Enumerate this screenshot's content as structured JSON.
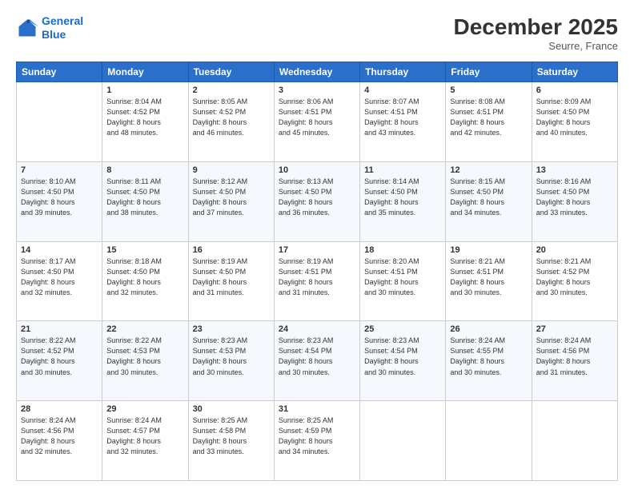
{
  "header": {
    "logo_line1": "General",
    "logo_line2": "Blue",
    "month": "December 2025",
    "location": "Seurre, France"
  },
  "days": [
    "Sunday",
    "Monday",
    "Tuesday",
    "Wednesday",
    "Thursday",
    "Friday",
    "Saturday"
  ],
  "weeks": [
    [
      {
        "day": "",
        "content": ""
      },
      {
        "day": "1",
        "content": "Sunrise: 8:04 AM\nSunset: 4:52 PM\nDaylight: 8 hours\nand 48 minutes."
      },
      {
        "day": "2",
        "content": "Sunrise: 8:05 AM\nSunset: 4:52 PM\nDaylight: 8 hours\nand 46 minutes."
      },
      {
        "day": "3",
        "content": "Sunrise: 8:06 AM\nSunset: 4:51 PM\nDaylight: 8 hours\nand 45 minutes."
      },
      {
        "day": "4",
        "content": "Sunrise: 8:07 AM\nSunset: 4:51 PM\nDaylight: 8 hours\nand 43 minutes."
      },
      {
        "day": "5",
        "content": "Sunrise: 8:08 AM\nSunset: 4:51 PM\nDaylight: 8 hours\nand 42 minutes."
      },
      {
        "day": "6",
        "content": "Sunrise: 8:09 AM\nSunset: 4:50 PM\nDaylight: 8 hours\nand 40 minutes."
      }
    ],
    [
      {
        "day": "7",
        "content": "Sunrise: 8:10 AM\nSunset: 4:50 PM\nDaylight: 8 hours\nand 39 minutes."
      },
      {
        "day": "8",
        "content": "Sunrise: 8:11 AM\nSunset: 4:50 PM\nDaylight: 8 hours\nand 38 minutes."
      },
      {
        "day": "9",
        "content": "Sunrise: 8:12 AM\nSunset: 4:50 PM\nDaylight: 8 hours\nand 37 minutes."
      },
      {
        "day": "10",
        "content": "Sunrise: 8:13 AM\nSunset: 4:50 PM\nDaylight: 8 hours\nand 36 minutes."
      },
      {
        "day": "11",
        "content": "Sunrise: 8:14 AM\nSunset: 4:50 PM\nDaylight: 8 hours\nand 35 minutes."
      },
      {
        "day": "12",
        "content": "Sunrise: 8:15 AM\nSunset: 4:50 PM\nDaylight: 8 hours\nand 34 minutes."
      },
      {
        "day": "13",
        "content": "Sunrise: 8:16 AM\nSunset: 4:50 PM\nDaylight: 8 hours\nand 33 minutes."
      }
    ],
    [
      {
        "day": "14",
        "content": "Sunrise: 8:17 AM\nSunset: 4:50 PM\nDaylight: 8 hours\nand 32 minutes."
      },
      {
        "day": "15",
        "content": "Sunrise: 8:18 AM\nSunset: 4:50 PM\nDaylight: 8 hours\nand 32 minutes."
      },
      {
        "day": "16",
        "content": "Sunrise: 8:19 AM\nSunset: 4:50 PM\nDaylight: 8 hours\nand 31 minutes."
      },
      {
        "day": "17",
        "content": "Sunrise: 8:19 AM\nSunset: 4:51 PM\nDaylight: 8 hours\nand 31 minutes."
      },
      {
        "day": "18",
        "content": "Sunrise: 8:20 AM\nSunset: 4:51 PM\nDaylight: 8 hours\nand 30 minutes."
      },
      {
        "day": "19",
        "content": "Sunrise: 8:21 AM\nSunset: 4:51 PM\nDaylight: 8 hours\nand 30 minutes."
      },
      {
        "day": "20",
        "content": "Sunrise: 8:21 AM\nSunset: 4:52 PM\nDaylight: 8 hours\nand 30 minutes."
      }
    ],
    [
      {
        "day": "21",
        "content": "Sunrise: 8:22 AM\nSunset: 4:52 PM\nDaylight: 8 hours\nand 30 minutes."
      },
      {
        "day": "22",
        "content": "Sunrise: 8:22 AM\nSunset: 4:53 PM\nDaylight: 8 hours\nand 30 minutes."
      },
      {
        "day": "23",
        "content": "Sunrise: 8:23 AM\nSunset: 4:53 PM\nDaylight: 8 hours\nand 30 minutes."
      },
      {
        "day": "24",
        "content": "Sunrise: 8:23 AM\nSunset: 4:54 PM\nDaylight: 8 hours\nand 30 minutes."
      },
      {
        "day": "25",
        "content": "Sunrise: 8:23 AM\nSunset: 4:54 PM\nDaylight: 8 hours\nand 30 minutes."
      },
      {
        "day": "26",
        "content": "Sunrise: 8:24 AM\nSunset: 4:55 PM\nDaylight: 8 hours\nand 30 minutes."
      },
      {
        "day": "27",
        "content": "Sunrise: 8:24 AM\nSunset: 4:56 PM\nDaylight: 8 hours\nand 31 minutes."
      }
    ],
    [
      {
        "day": "28",
        "content": "Sunrise: 8:24 AM\nSunset: 4:56 PM\nDaylight: 8 hours\nand 32 minutes."
      },
      {
        "day": "29",
        "content": "Sunrise: 8:24 AM\nSunset: 4:57 PM\nDaylight: 8 hours\nand 32 minutes."
      },
      {
        "day": "30",
        "content": "Sunrise: 8:25 AM\nSunset: 4:58 PM\nDaylight: 8 hours\nand 33 minutes."
      },
      {
        "day": "31",
        "content": "Sunrise: 8:25 AM\nSunset: 4:59 PM\nDaylight: 8 hours\nand 34 minutes."
      },
      {
        "day": "",
        "content": ""
      },
      {
        "day": "",
        "content": ""
      },
      {
        "day": "",
        "content": ""
      }
    ]
  ]
}
